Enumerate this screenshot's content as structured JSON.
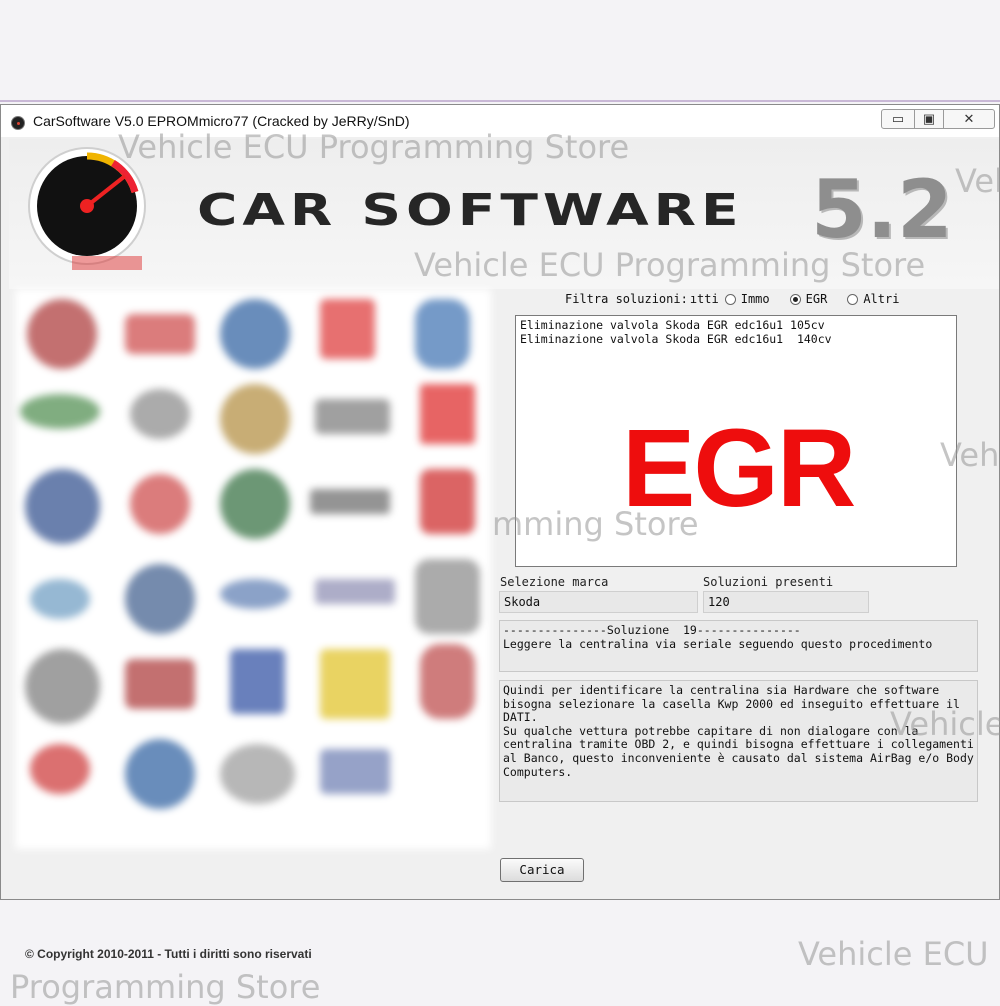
{
  "window": {
    "title": "CarSoftware V5.0 EPROMmicro77 (Cracked by JeRRy/SnD)",
    "controls": {
      "minimize": "▭",
      "maximize": "▣",
      "close": "✕"
    }
  },
  "banner": {
    "title": "CAR SOFTWARE",
    "version": "5.2"
  },
  "watermarks": {
    "w1": "Vehicle ECU Programming Store",
    "w2": "Vehicle ECU Programming Store",
    "w3": "Veh",
    "w4": "mming Store",
    "w5": "Vehicle",
    "w6": "Vehicle ECU",
    "w7": "Programming Store",
    "w8": "Veh"
  },
  "filter": {
    "label": "Filtra soluzioni:",
    "label_tail": "ıtti",
    "options": [
      {
        "label": "Immo",
        "selected": false
      },
      {
        "label": "EGR",
        "selected": true
      },
      {
        "label": "Altri",
        "selected": false
      }
    ]
  },
  "solutions_list": [
    "Eliminazione valvola Skoda EGR edc16u1 105cv",
    "Eliminazione valvola Skoda EGR edc16u1  140cv"
  ],
  "overlay_text": "EGR",
  "brand": {
    "label": "Selezione marca",
    "value": "Skoda"
  },
  "solutions_count": {
    "label": "Soluzioni presenti",
    "value": "120"
  },
  "solution_header": "---------------Soluzione  19---------------\nLeggere la centralina via seriale seguendo questo procedimento",
  "solution_body": "Quindi per identificare la centralina sia Hardware che software\nbisogna selezionare la casella Kwp 2000 ed inseguito effettuare il\nDATI.\nSu qualche vettura potrebbe capitare di non dialogare con la\ncentralina tramite OBD 2, e quindi bisogna effettuare i collegamenti\nal Banco, questo inconveniente è causato dal sistema AirBag e/o Body\nComputers.",
  "load_button": "Carica",
  "copyright": "© Copyright 2010-2011 - Tutti i diritti sono riservati",
  "colors": {
    "accent_red": "#ee0d0d",
    "gauge_yellow": "#f0b400"
  }
}
